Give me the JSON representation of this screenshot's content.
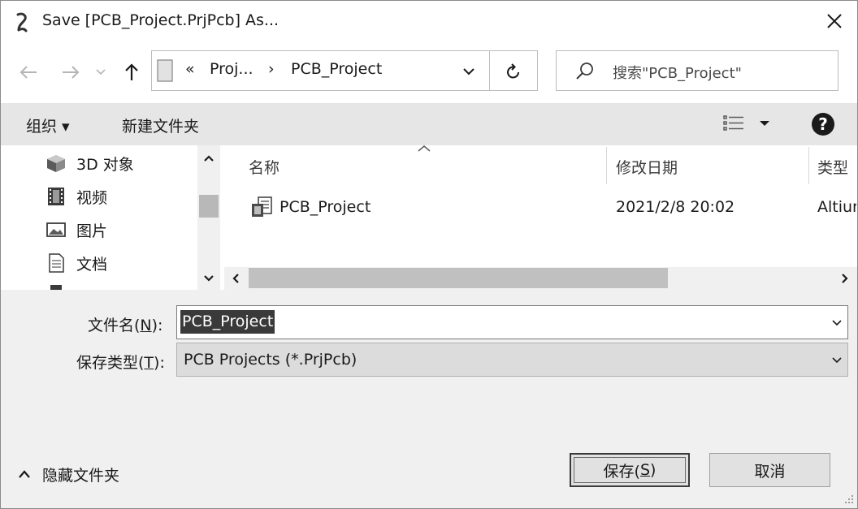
{
  "window": {
    "title": "Save [PCB_Project.PrjPcb] As...",
    "close_icon": "close-icon",
    "app_icon": "altium-icon"
  },
  "nav": {
    "back_icon": "arrow-left-icon",
    "forward_icon": "arrow-right-icon",
    "recent_icon": "chevron-down-icon",
    "up_icon": "arrow-up-icon",
    "breadcrumb_overflow": "«",
    "breadcrumb_parent": "Proj...",
    "breadcrumb_sep": "›",
    "breadcrumb_current": "PCB_Project",
    "refresh_icon": "refresh-icon",
    "search_placeholder": "搜索\"PCB_Project\""
  },
  "toolbar": {
    "organize_label": "组织 ▾",
    "new_folder_label": "新建文件夹",
    "view_icon": "details-view-icon",
    "help_label": "?"
  },
  "nav_pane": {
    "items": [
      {
        "label": "3D 对象",
        "icon": "3d-objects-icon"
      },
      {
        "label": "视频",
        "icon": "video-icon"
      },
      {
        "label": "图片",
        "icon": "pictures-icon"
      },
      {
        "label": "文档",
        "icon": "documents-icon"
      }
    ]
  },
  "file_list": {
    "columns": [
      "名称",
      "修改日期",
      "类型"
    ],
    "rows": [
      {
        "name": "PCB_Project",
        "modified": "2021/2/8 20:02",
        "type": "Altiur"
      }
    ]
  },
  "form": {
    "filename_label_pre": "文件名(",
    "filename_label_key": "N",
    "filename_label_post": "):",
    "filename_value": "PCB_Project",
    "filetype_label_pre": "保存类型(",
    "filetype_label_key": "T",
    "filetype_label_post": "):",
    "filetype_value": "PCB Projects (*.PrjPcb)"
  },
  "footer": {
    "hide_folders_label": "隐藏文件夹",
    "save_label_pre": "保存(",
    "save_label_key": "S",
    "save_label_post": ")",
    "cancel_label": "取消"
  },
  "colors": {
    "window_bg": "#f0f0f0",
    "toolbar_bg": "#e6e6e6",
    "selection_bg": "#3a3a3a"
  }
}
